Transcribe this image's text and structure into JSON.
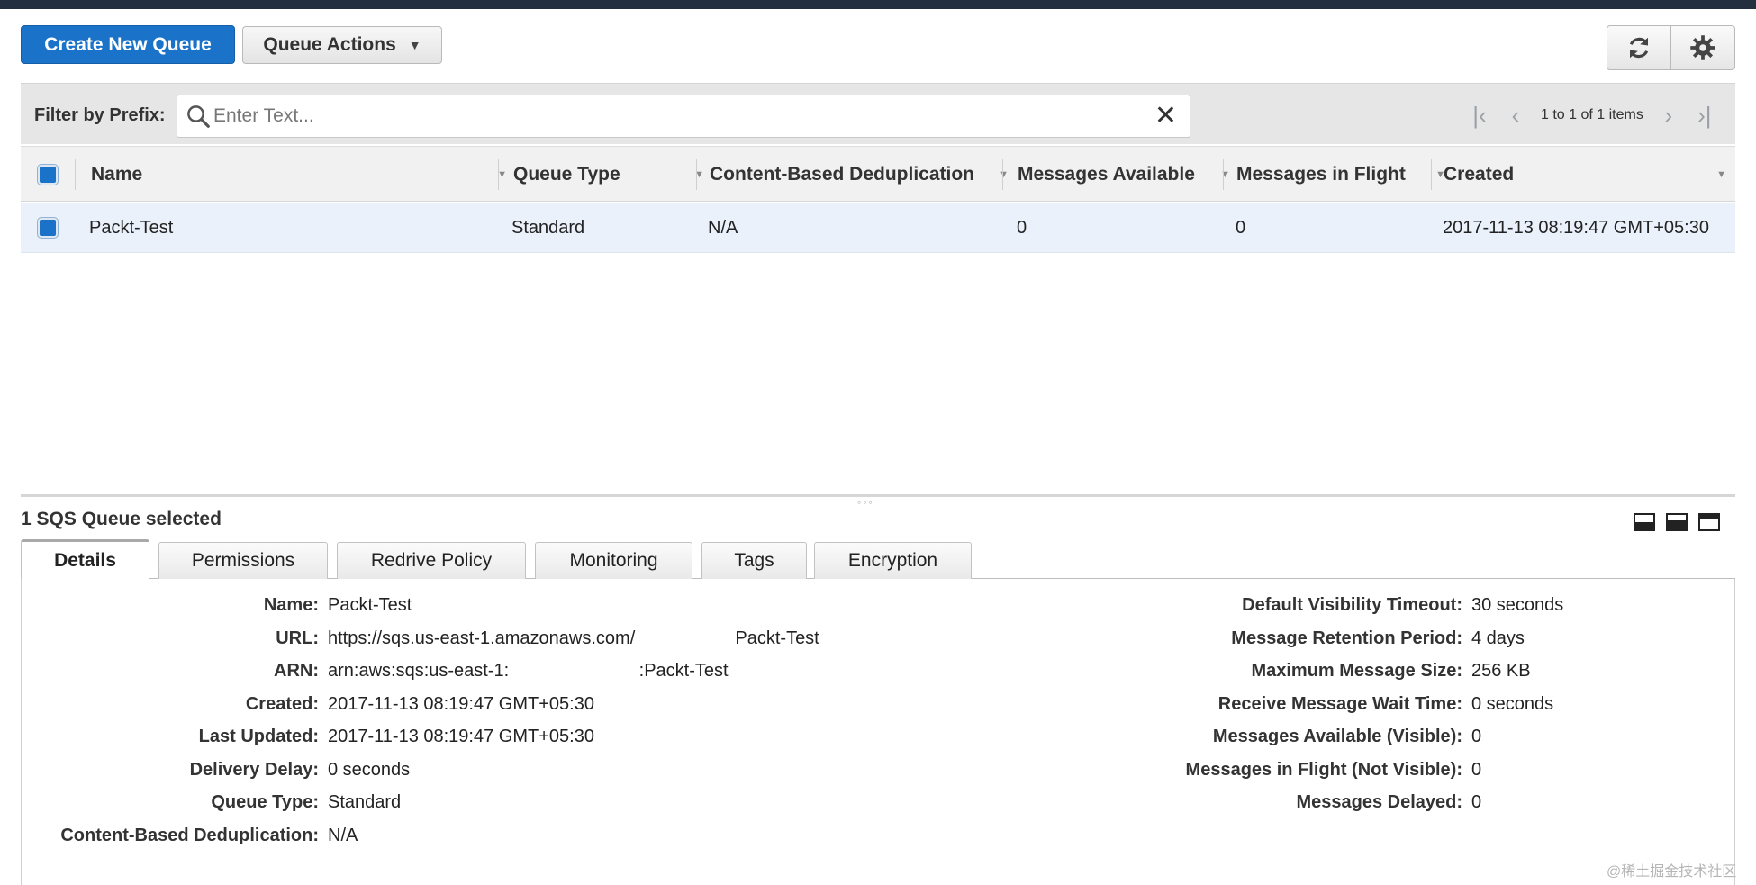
{
  "toolbar": {
    "create_label": "Create New Queue",
    "actions_label": "Queue Actions",
    "actions_caret": "▼",
    "refresh_icon": "refresh-icon",
    "settings_icon": "gear-icon"
  },
  "filter": {
    "label": "Filter by Prefix:",
    "placeholder": "Enter Text...",
    "clear_glyph": "✕"
  },
  "pagination": {
    "first": "|‹",
    "prev": "‹",
    "text": "1 to 1 of 1 items",
    "next": "›",
    "last": "›|"
  },
  "table": {
    "columns": [
      "Name",
      "Queue Type",
      "Content-Based Deduplication",
      "Messages Available",
      "Messages in Flight",
      "Created"
    ],
    "rows": [
      {
        "name": "Packt-Test",
        "queue_type": "Standard",
        "dedup": "N/A",
        "available": "0",
        "in_flight": "0",
        "created": "2017-11-13 08:19:47 GMT+05:30"
      }
    ]
  },
  "details": {
    "selected_title": "1 SQS Queue selected",
    "tabs": [
      "Details",
      "Permissions",
      "Redrive Policy",
      "Monitoring",
      "Tags",
      "Encryption"
    ],
    "left": [
      {
        "k": "Name:",
        "v": "Packt-Test"
      },
      {
        "k": "URL:",
        "v": "https://sqs.us-east-1.amazonaws.com/                    Packt-Test"
      },
      {
        "k": "ARN:",
        "v": "arn:aws:sqs:us-east-1:                          :Packt-Test"
      },
      {
        "k": "Created:",
        "v": "2017-11-13 08:19:47 GMT+05:30"
      },
      {
        "k": "Last Updated:",
        "v": "2017-11-13 08:19:47 GMT+05:30"
      },
      {
        "k": "Delivery Delay:",
        "v": "0 seconds"
      },
      {
        "k": "Queue Type:",
        "v": "Standard"
      },
      {
        "k": "Content-Based Deduplication:",
        "v": "N/A"
      }
    ],
    "right": [
      {
        "k": "Default Visibility Timeout:",
        "v": "30 seconds"
      },
      {
        "k": "Message Retention Period:",
        "v": "4 days"
      },
      {
        "k": "Maximum Message Size:",
        "v": "256 KB"
      },
      {
        "k": "Receive Message Wait Time:",
        "v": "0 seconds"
      },
      {
        "k": "Messages Available (Visible):",
        "v": "0"
      },
      {
        "k": "Messages in Flight (Not Visible):",
        "v": "0"
      },
      {
        "k": "Messages Delayed:",
        "v": "0"
      }
    ]
  },
  "watermark": "@稀土掘金技术社区",
  "colors": {
    "primary": "#1a73c9",
    "header_bar": "#232f3e",
    "selected_row": "#eaf1fb"
  }
}
